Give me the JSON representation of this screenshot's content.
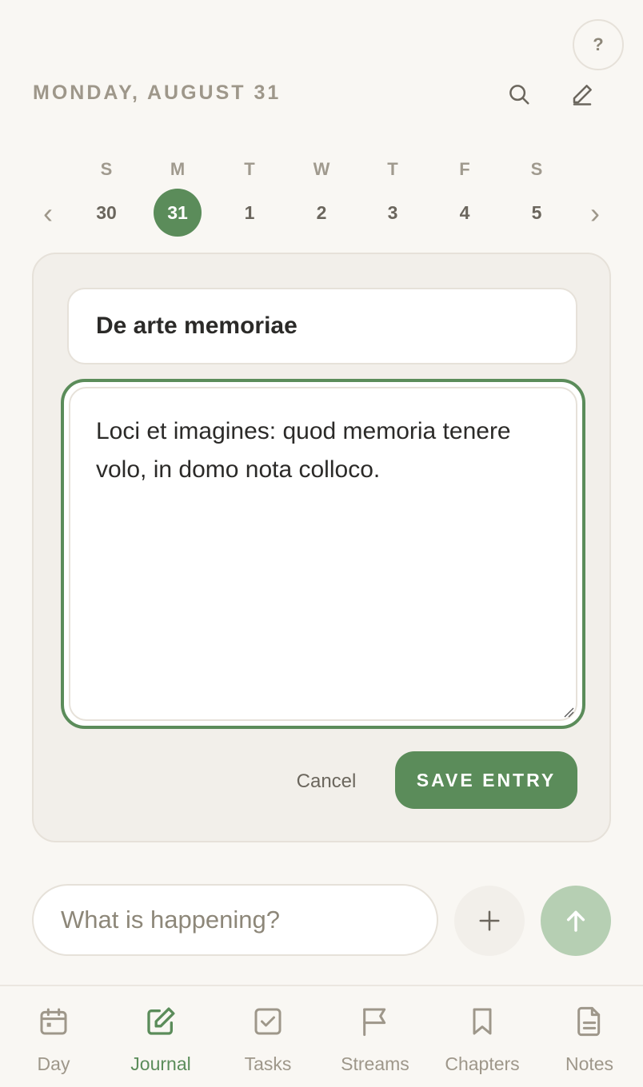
{
  "header": {
    "date_title": "MONDAY, AUGUST 31",
    "help_label": "?"
  },
  "week": {
    "prev_glyph": "‹",
    "next_glyph": "›",
    "days": [
      {
        "letter": "S",
        "num": "30",
        "selected": false
      },
      {
        "letter": "M",
        "num": "31",
        "selected": true
      },
      {
        "letter": "T",
        "num": "1",
        "selected": false
      },
      {
        "letter": "W",
        "num": "2",
        "selected": false
      },
      {
        "letter": "T",
        "num": "3",
        "selected": false
      },
      {
        "letter": "F",
        "num": "4",
        "selected": false
      },
      {
        "letter": "S",
        "num": "5",
        "selected": false
      }
    ]
  },
  "editor": {
    "title_value": "De arte memoriae",
    "body_value": "Loci et imagines: quod memoria tenere volo, in domo nota colloco.",
    "cancel_label": "Cancel",
    "save_label": "SAVE ENTRY"
  },
  "compose": {
    "placeholder": "What is happening?"
  },
  "tabs": [
    {
      "label": "Day",
      "icon": "calendar-icon",
      "active": false
    },
    {
      "label": "Journal",
      "icon": "journal-edit-icon",
      "active": true
    },
    {
      "label": "Tasks",
      "icon": "checkbox-icon",
      "active": false
    },
    {
      "label": "Streams",
      "icon": "flag-icon",
      "active": false
    },
    {
      "label": "Chapters",
      "icon": "bookmark-icon",
      "active": false
    },
    {
      "label": "Notes",
      "icon": "document-icon",
      "active": false
    }
  ],
  "colors": {
    "accent": "#5b8c5a",
    "accent_light": "#b6cfb3",
    "muted_text": "#9e978a",
    "background": "#f9f7f3",
    "card": "#f2efea"
  }
}
